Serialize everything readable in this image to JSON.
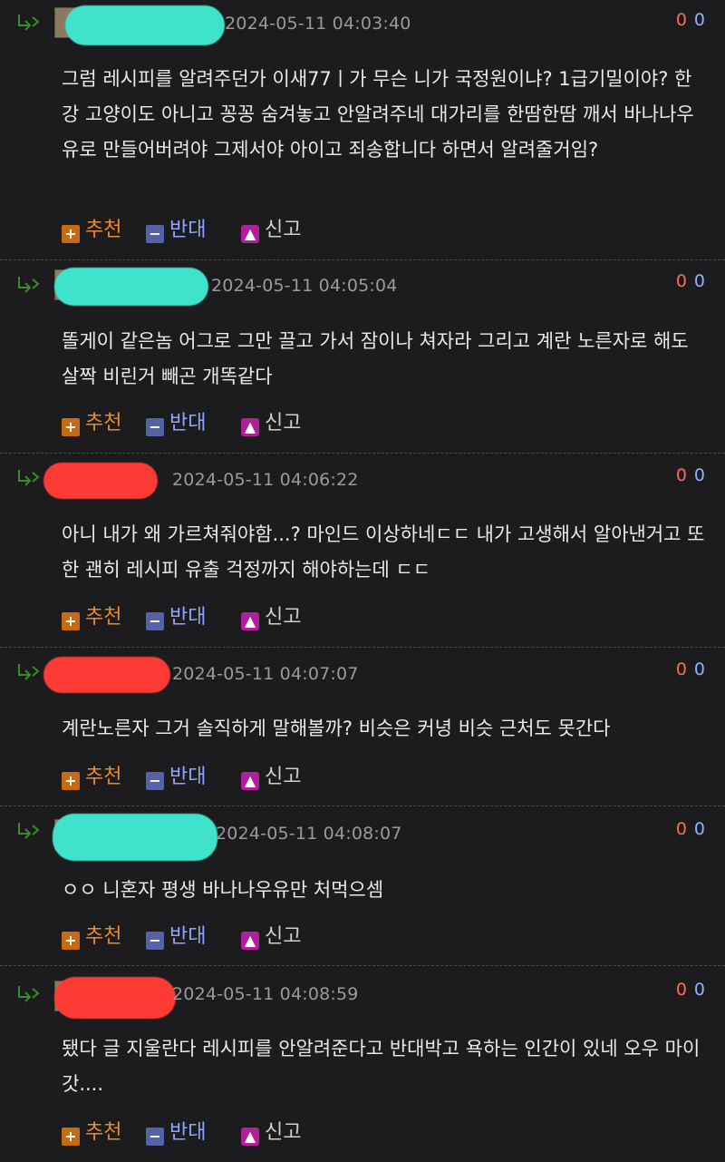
{
  "actions": {
    "recommend": "추천",
    "oppose": "반대",
    "report": "신고"
  },
  "comments": [
    {
      "redact_color": "teal",
      "timestamp": "2024-05-11 04:03:40",
      "up": "0",
      "down": "0",
      "text": "그럼 레시피를 알려주던가 이새77ㅣ가 무슨 니가 국정원이냐? 1급기밀이야? 한강 고양이도 아니고 꽁꽁 숨겨놓고 안알려주네 대가리를 한땀한땀 깨서 바나나우유로 만들어버려야 그제서야 아이고 죄송합니다 하면서 알려줄거임?"
    },
    {
      "redact_color": "teal",
      "timestamp": "2024-05-11 04:05:04",
      "up": "0",
      "down": "0",
      "text": "똘게이 같은놈 어그로 그만 끌고 가서 잠이나 쳐자라 그리고 계란 노른자로 해도 살짝 비린거 빼곤 개똑같다"
    },
    {
      "redact_color": "red",
      "timestamp": "2024-05-11 04:06:22",
      "up": "0",
      "down": "0",
      "text": "아니 내가 왜 가르쳐줘야함...? 마인드 이상하네ㄷㄷ 내가 고생해서 알아낸거고 또한 괜히 레시피 유출 걱정까지 해야하는데 ㄷㄷ"
    },
    {
      "redact_color": "red",
      "timestamp": "2024-05-11 04:07:07",
      "up": "0",
      "down": "0",
      "text": "계란노른자 그거 솔직하게 말해볼까? 비슷은 커녕 비슷 근처도 못간다"
    },
    {
      "redact_color": "teal",
      "timestamp": "2024-05-11 04:08:07",
      "up": "0",
      "down": "0",
      "text": "ㅇㅇ 니혼자 평생 바나나우유만 처먹으셈"
    },
    {
      "redact_color": "red",
      "timestamp": "2024-05-11 04:08:59",
      "up": "0",
      "down": "0",
      "text": "됐다 글 지울란다 레시피를 안알려준다고 반대박고 욕하는 인간이 있네 오우 마이갓...."
    }
  ]
}
